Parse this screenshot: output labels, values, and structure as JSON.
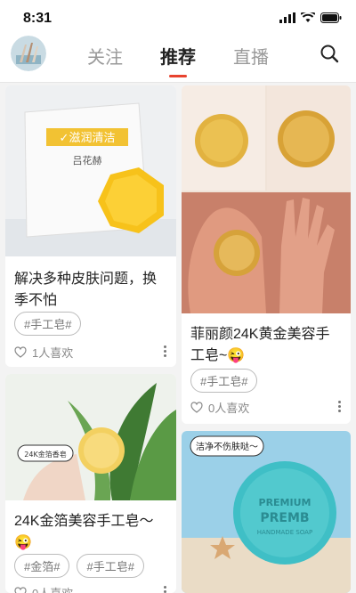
{
  "status": {
    "time": "8:31"
  },
  "nav": {
    "tabs": [
      "关注",
      "推荐",
      "直播"
    ],
    "active_index": 1
  },
  "feed": [
    {
      "title": "解决多种皮肤问题，换季不怕",
      "tags": [
        "#手工皂#"
      ],
      "likes": "1人喜欢",
      "image_text": [
        "✓滋润清洁",
        "吕花赫"
      ]
    },
    {
      "title": "菲丽颜24K黄金美容手工皂~😜",
      "tags": [
        "#手工皂#"
      ],
      "likes": "0人喜欢"
    },
    {
      "title": "24K金箔美容手工皂～😜",
      "tags": [
        "#金箔#",
        "#手工皂#"
      ],
      "likes": "0人喜欢",
      "image_text": [
        "24K金箔香皂"
      ]
    },
    {
      "title": "",
      "tags": [],
      "likes": "",
      "image_text": [
        "洁净不伤肤哒～",
        "PREMIUM",
        "PREMB",
        "HANDMADE SOAP"
      ]
    }
  ],
  "colors": {
    "accent": "#e8432e",
    "background": "#f3f3f3"
  }
}
